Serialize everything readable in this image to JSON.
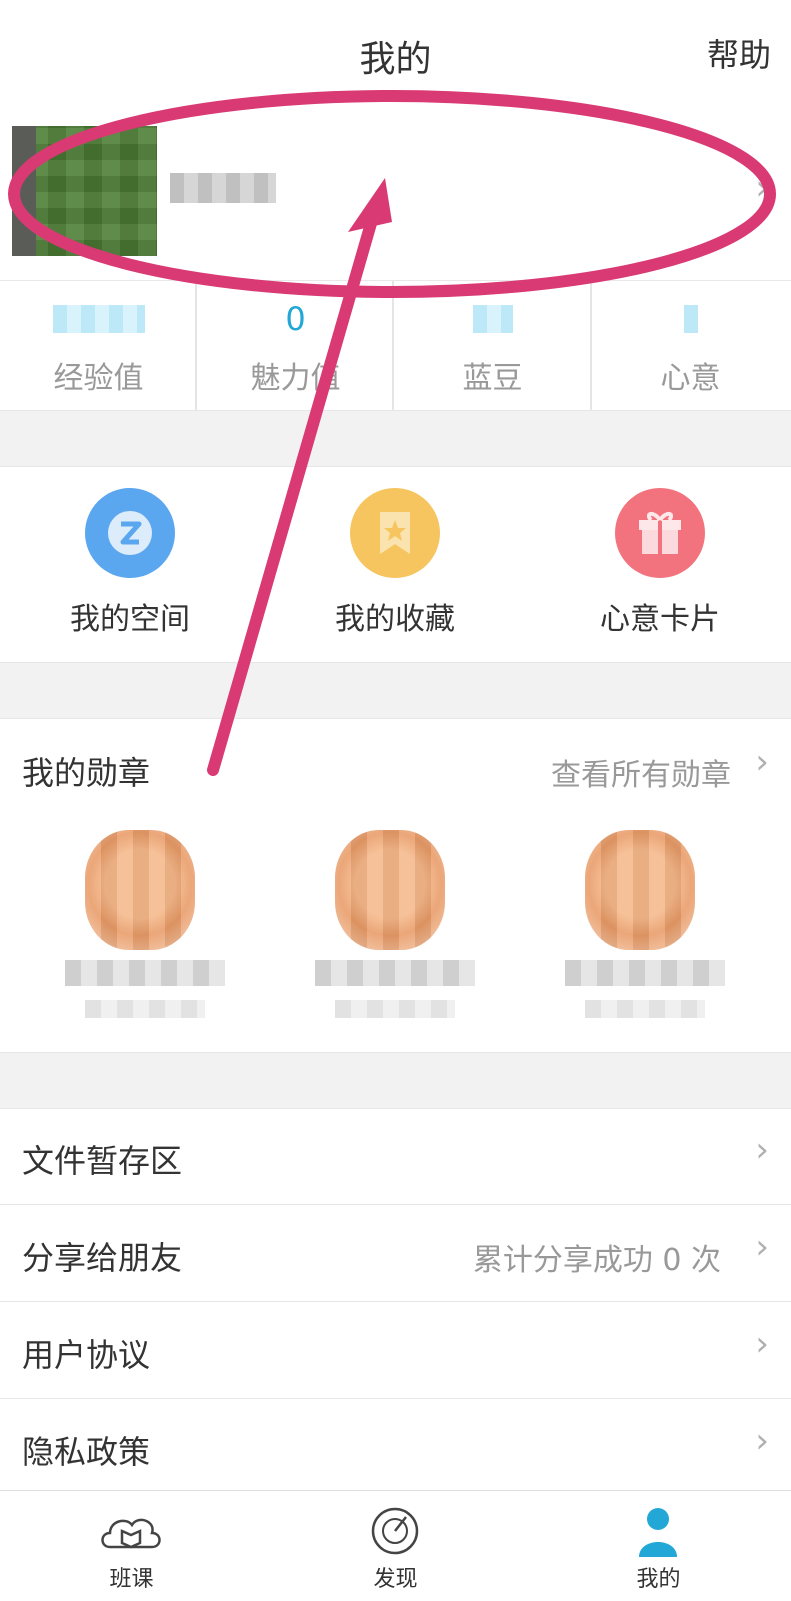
{
  "header": {
    "title": "我的",
    "help": "帮助"
  },
  "profile": {
    "chevron": "›"
  },
  "stats": [
    {
      "value": "",
      "label": "经验值"
    },
    {
      "value": "0",
      "label": "魅力值"
    },
    {
      "value": "",
      "label": "蓝豆"
    },
    {
      "value": "",
      "label": "心意"
    }
  ],
  "shortcuts": [
    {
      "label": "我的空间",
      "icon": "space-icon",
      "color": "#5aa7ef"
    },
    {
      "label": "我的收藏",
      "icon": "bookmark-star-icon",
      "color": "#f6c55f"
    },
    {
      "label": "心意卡片",
      "icon": "gift-icon",
      "color": "#f2737d"
    }
  ],
  "medals": {
    "title": "我的勋章",
    "view_all": "查看所有勋章",
    "chevron": "›"
  },
  "menu": [
    {
      "label": "文件暂存区",
      "extra": "",
      "chevron": "›"
    },
    {
      "label": "分享给朋友",
      "extra": "累计分享成功 0 次",
      "chevron": "›"
    },
    {
      "label": "用户协议",
      "extra": "",
      "chevron": "›"
    },
    {
      "label": "隐私政策",
      "extra": "",
      "chevron": "›"
    }
  ],
  "tabs": [
    {
      "label": "班课",
      "icon": "cloud-book-icon"
    },
    {
      "label": "发现",
      "icon": "compass-icon"
    },
    {
      "label": "我的",
      "icon": "person-icon"
    }
  ],
  "colors": {
    "annotation": "#d93a73",
    "accent": "#22a7d6"
  }
}
